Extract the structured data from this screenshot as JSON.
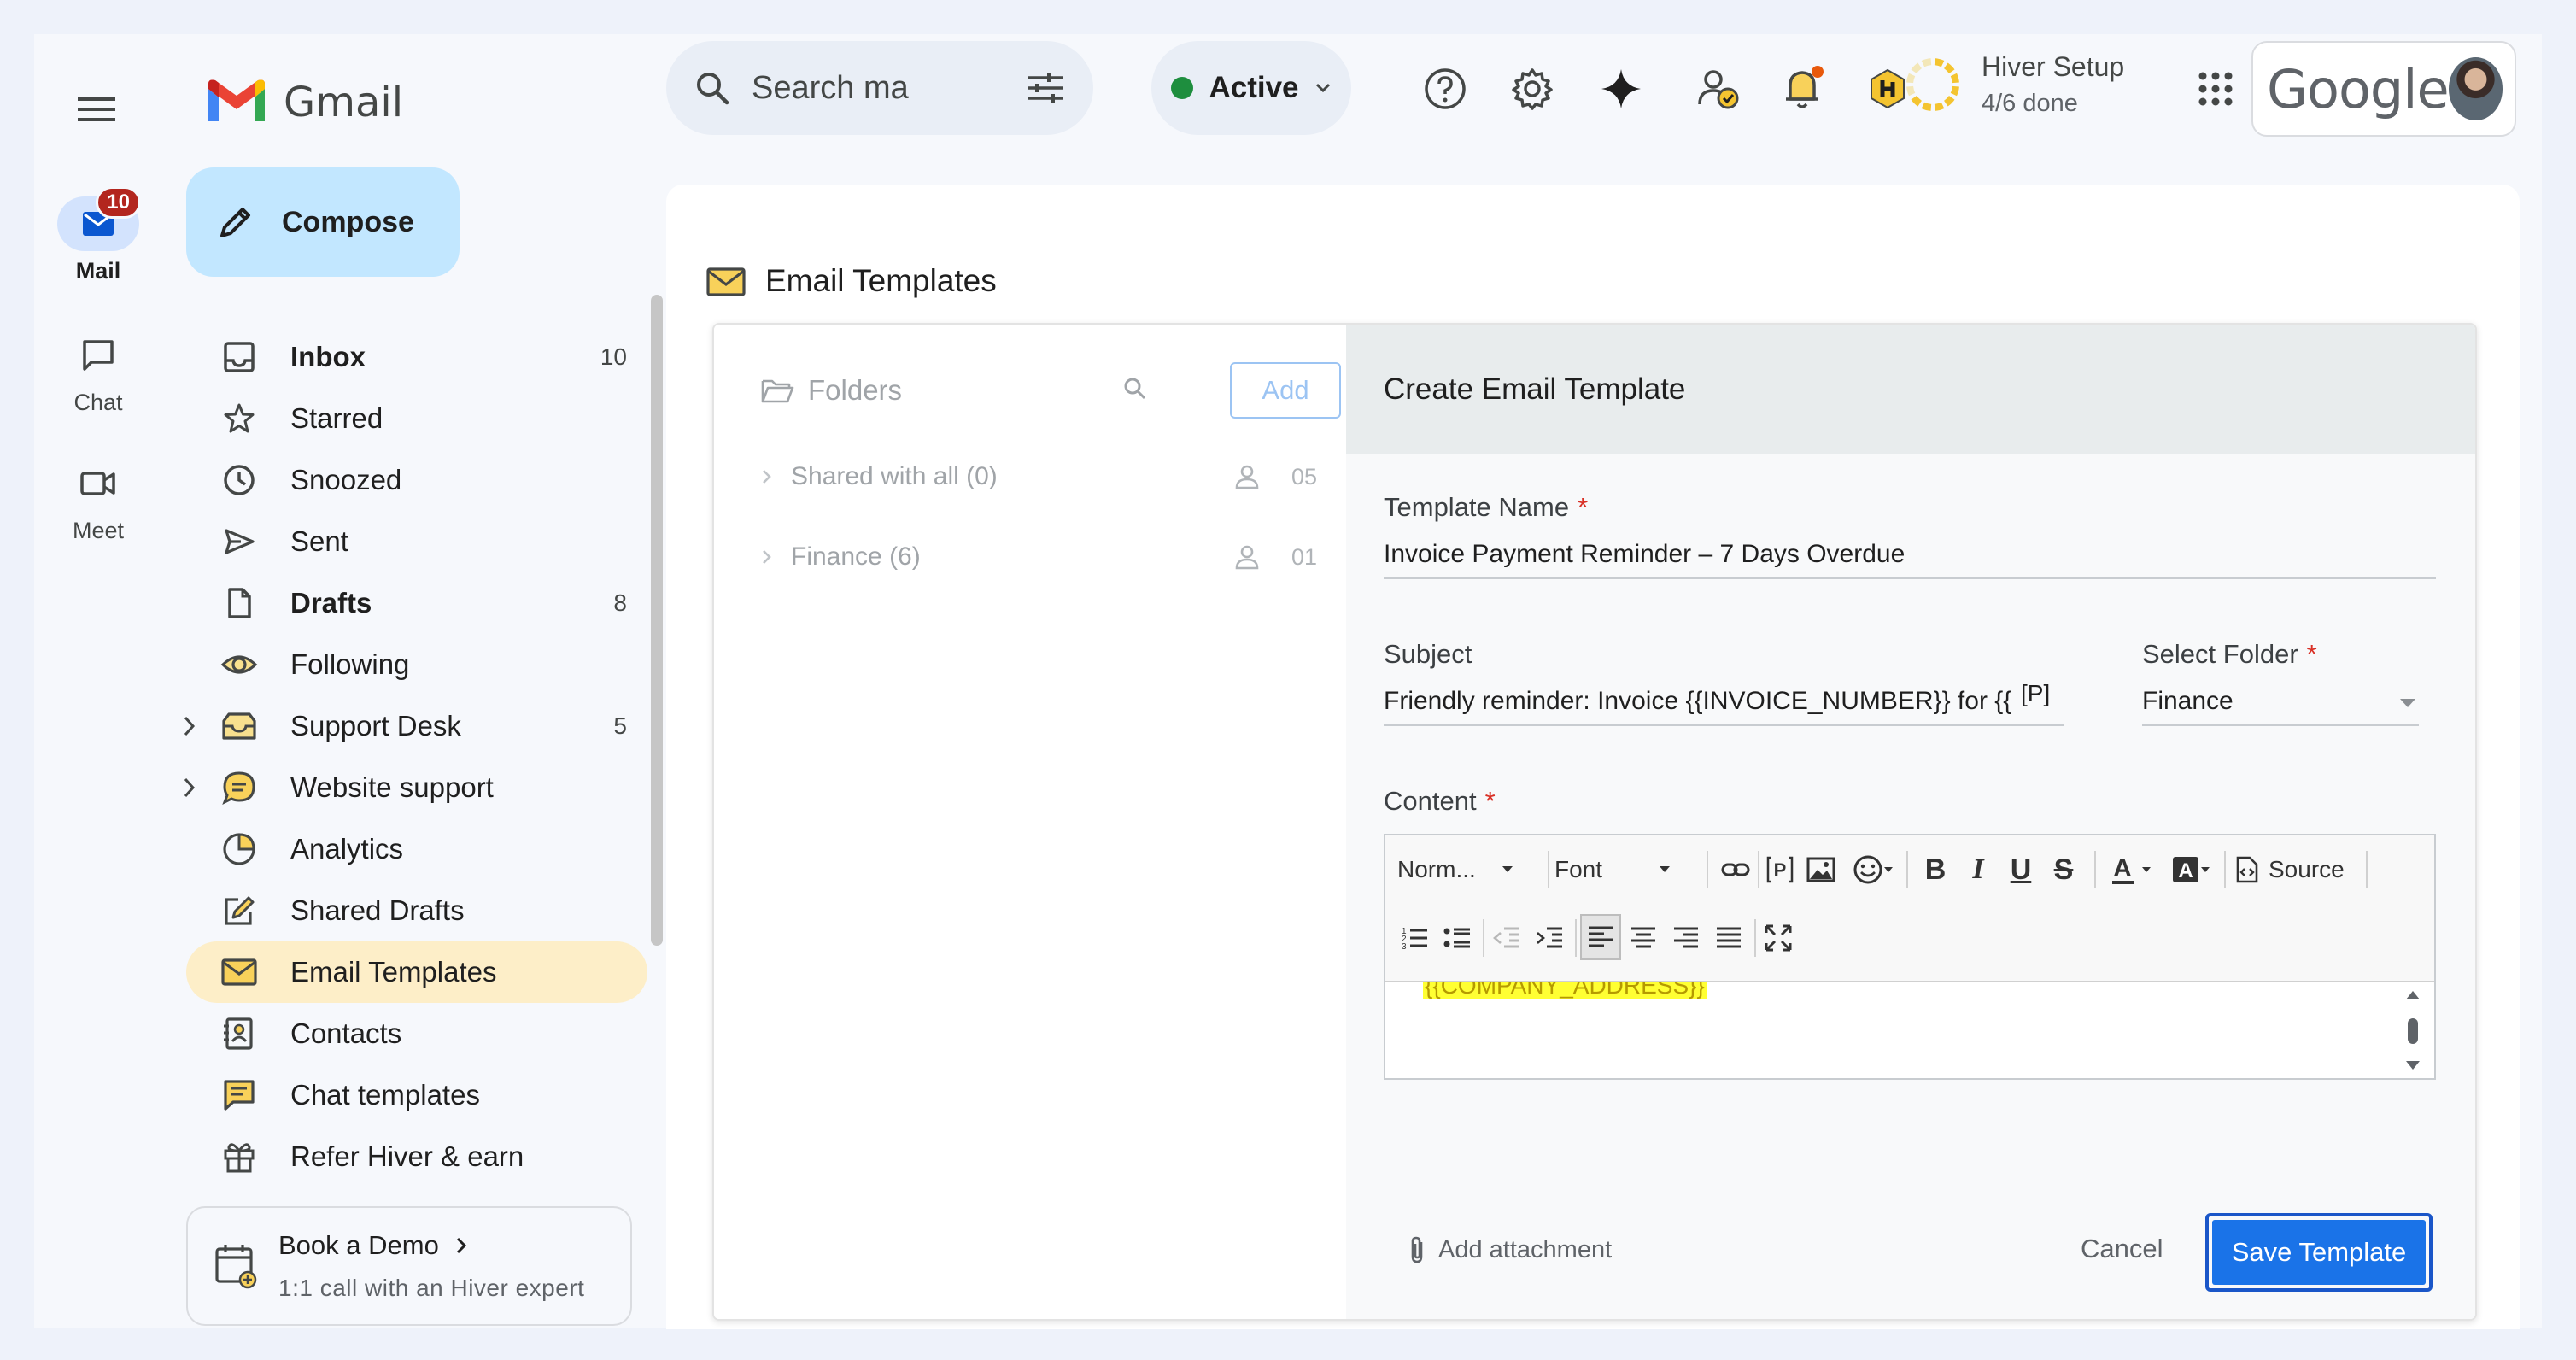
{
  "rail": {
    "items": [
      {
        "label": "Mail",
        "icon": "mail-icon",
        "badge": "10",
        "active": true
      },
      {
        "label": "Chat",
        "icon": "chat-icon"
      },
      {
        "label": "Meet",
        "icon": "video-icon"
      }
    ]
  },
  "header": {
    "app_name": "Gmail",
    "search_placeholder": "Search ma",
    "status": "Active",
    "hiver_setup_title": "Hiver Setup",
    "hiver_setup_progress": "4/6 done",
    "hiver_setup_fraction": 0.667,
    "google_wordmark": "Google"
  },
  "sidebar": {
    "compose_label": "Compose",
    "items": [
      {
        "label": "Inbox",
        "count": "10",
        "icon": "inbox-icon",
        "bold": true
      },
      {
        "label": "Starred",
        "count": "",
        "icon": "star-icon"
      },
      {
        "label": "Snoozed",
        "count": "",
        "icon": "clock-icon"
      },
      {
        "label": "Sent",
        "count": "",
        "icon": "send-icon"
      },
      {
        "label": "Drafts",
        "count": "8",
        "icon": "draft-icon",
        "bold": true
      },
      {
        "label": "Following",
        "count": "",
        "icon": "eye-icon"
      },
      {
        "label": "Support Desk",
        "count": "5",
        "icon": "shared-inbox-icon",
        "expandable": true
      },
      {
        "label": "Website support",
        "count": "",
        "icon": "chat-bubble-icon",
        "expandable": true
      },
      {
        "label": "Analytics",
        "count": "",
        "icon": "pie-chart-icon"
      },
      {
        "label": "Shared Drafts",
        "count": "",
        "icon": "edit-square-icon"
      },
      {
        "label": "Email Templates",
        "count": "",
        "icon": "template-mail-icon",
        "active": true
      },
      {
        "label": "Contacts",
        "count": "",
        "icon": "contacts-icon"
      },
      {
        "label": "Chat templates",
        "count": "",
        "icon": "chat-template-icon"
      },
      {
        "label": "Refer Hiver & earn",
        "count": "",
        "icon": "gift-icon"
      }
    ],
    "demo_title": "Book a Demo",
    "demo_subtitle": "1:1 call with an Hiver expert"
  },
  "main": {
    "title": "Email Templates",
    "folders": {
      "header": "Folders",
      "add_label": "Add",
      "rows": [
        {
          "label": "Shared with all (0)",
          "count": "05"
        },
        {
          "label": "Finance (6)",
          "count": "01"
        }
      ]
    },
    "editor": {
      "title": "Create Email Template",
      "template_name_label": "Template Name",
      "template_name_value": "Invoice Payment Reminder – 7 Days Overdue",
      "subject_label": "Subject",
      "subject_value": "Friendly reminder: Invoice {{INVOICE_NUMBER}} for {{",
      "subject_placeholder_tag": "[P]",
      "folder_label": "Select Folder",
      "folder_value": "Finance",
      "content_label": "Content",
      "required_mark": "*",
      "toolbar": {
        "format": "Norm...",
        "font": "Font",
        "source": "Source"
      },
      "content_visible_text": "{{COMPANY_ADDRESS}}",
      "add_attachment": "Add attachment",
      "cancel": "Cancel",
      "save": "Save Template"
    }
  },
  "colors": {
    "compose_bg": "#c2e7ff",
    "active_nav_bg": "#fdeec8",
    "primary_button": "#1a73e8",
    "status_dot": "#1e8e3e",
    "badge": "#b3261e"
  }
}
